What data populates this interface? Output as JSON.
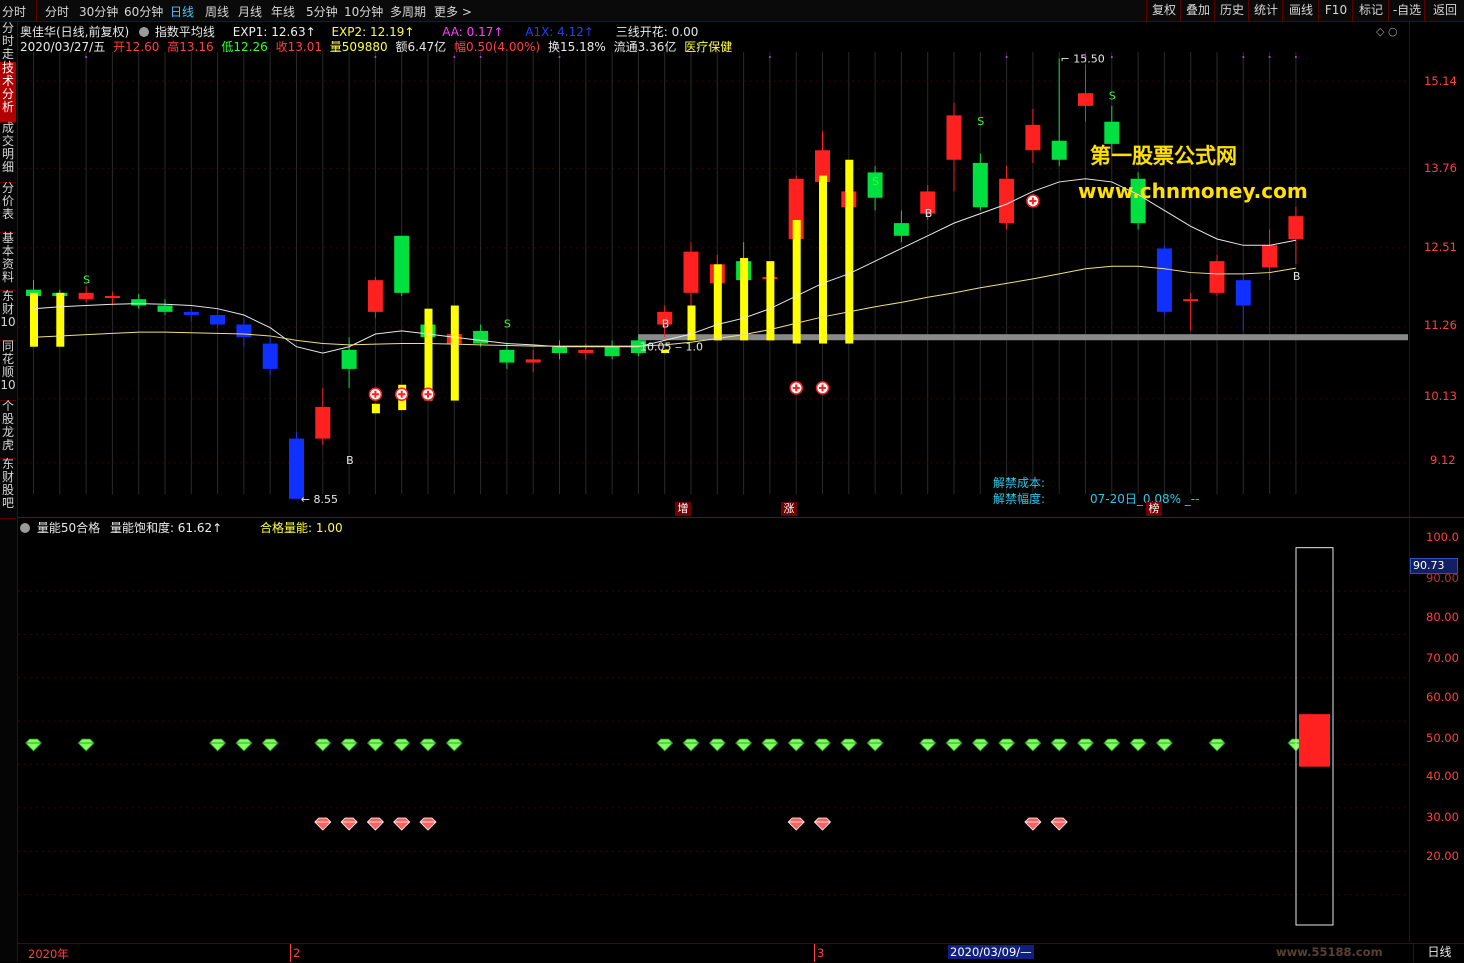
{
  "topbar": {
    "left_tab": "分时",
    "periods": [
      "分时",
      "30分钟",
      "60分钟",
      "日线",
      "周线",
      "月线",
      "年线",
      "5分钟",
      "10分钟",
      "多周期",
      "更多 >"
    ],
    "active_period": "日线",
    "right_buttons": [
      "复权",
      "叠加",
      "历史",
      "统计",
      "画线",
      "F10",
      "标记",
      "-自选",
      "返回"
    ]
  },
  "sidebar": {
    "tabs": [
      "分时走势",
      "技术分析",
      "成交明细",
      "分价表",
      "基本资料",
      "东财10",
      "同花顺10",
      "个股龙虎",
      "东财股吧"
    ],
    "active": "技术分析"
  },
  "main": {
    "stock_title": "奥佳华(日线,前复权)",
    "indicator_name": "指数平均线",
    "exp1": "EXP1: 12.63↑",
    "exp2": "EXP2: 12.19↑",
    "aa": "AA: 0.17↑",
    "a1x": "A1X: 4.12↑",
    "sanxian": "三线开花: 0.00",
    "date": "2020/03/27/五",
    "open": "开12.60",
    "high": "高13.16",
    "low": "低12.26",
    "close": "收13.01",
    "volume": "量509880",
    "amount": "额6.47亿",
    "amplitude": "幅0.50(4.00%)",
    "turnover": "换15.18%",
    "float_cap": "流通3.36亿",
    "sector": "医疗保健",
    "price_axis": [
      "15.14",
      "13.76",
      "12.51",
      "11.26",
      "10.13",
      "9.12"
    ],
    "high_marker": "15.50",
    "low_marker": "8.55",
    "mid_marker": "10.05 ‒ 1.0",
    "unlock_cost_label": "解禁成本:",
    "unlock_range_label": "解禁幅度:",
    "unlock_value": "07-20日_0.08% _--",
    "event_labels": [
      "增",
      "涨",
      "榜"
    ],
    "watermark_title": "第一股票公式网",
    "watermark_url": "www.chnmoney.com",
    "signal_s": "S",
    "signal_b": "B",
    "colors": {
      "up": "#ff2020",
      "down": "#00e040",
      "yellow": "#ffff00",
      "blue": "#1030ff",
      "ma_white": "#e8e8e8",
      "ma_yellow": "#f0e080"
    }
  },
  "sub": {
    "indicator_name": "量能50合格",
    "saturation": "量能饱和度: 61.62↑",
    "qualified": "合格量能: 1.00",
    "axis": [
      "100.0",
      "90.00",
      "80.00",
      "70.00",
      "60.00",
      "50.00",
      "40.00",
      "30.00",
      "20.00"
    ],
    "current_value": "90.73",
    "gauge_value": 61.62
  },
  "bottom": {
    "labels": [
      "2020年",
      "2",
      "3",
      "2020/03/09/—",
      "日线"
    ],
    "watermark": "www.55188.com"
  },
  "chart_data": {
    "type": "candlestick",
    "price_range": [
      8.5,
      15.6
    ],
    "candles": [
      {
        "o": 11.85,
        "c": 11.75,
        "h": 12.0,
        "l": 11.7
      },
      {
        "o": 11.8,
        "c": 11.75,
        "h": 11.85,
        "l": 11.65
      },
      {
        "o": 11.7,
        "c": 11.8,
        "h": 11.9,
        "l": 11.65
      },
      {
        "o": 11.75,
        "c": 11.75,
        "h": 11.82,
        "l": 11.6
      },
      {
        "o": 11.7,
        "c": 11.6,
        "h": 11.78,
        "l": 11.55
      },
      {
        "o": 11.6,
        "c": 11.5,
        "h": 11.7,
        "l": 11.45
      },
      {
        "o": 11.5,
        "c": 11.45,
        "h": 11.55,
        "l": 11.35
      },
      {
        "o": 11.45,
        "c": 11.3,
        "h": 11.55,
        "l": 11.25
      },
      {
        "o": 11.3,
        "c": 11.1,
        "h": 11.4,
        "l": 10.95
      },
      {
        "o": 11.0,
        "c": 10.6,
        "h": 11.1,
        "l": 10.5
      },
      {
        "o": 9.5,
        "c": 8.55,
        "h": 9.6,
        "l": 8.55
      },
      {
        "o": 9.5,
        "c": 10.0,
        "h": 10.3,
        "l": 9.4
      },
      {
        "o": 10.9,
        "c": 10.6,
        "h": 11.1,
        "l": 10.3
      },
      {
        "o": 11.5,
        "c": 12.0,
        "h": 12.05,
        "l": 11.4
      },
      {
        "o": 12.7,
        "c": 11.8,
        "h": 12.7,
        "l": 11.75
      },
      {
        "o": 11.3,
        "c": 11.1,
        "h": 11.5,
        "l": 10.8
      },
      {
        "o": 11.0,
        "c": 11.15,
        "h": 11.25,
        "l": 10.95
      },
      {
        "o": 11.2,
        "c": 11.0,
        "h": 11.3,
        "l": 10.95
      },
      {
        "o": 10.9,
        "c": 10.7,
        "h": 11.0,
        "l": 10.6
      },
      {
        "o": 10.7,
        "c": 10.75,
        "h": 10.9,
        "l": 10.55
      },
      {
        "o": 10.95,
        "c": 10.85,
        "h": 11.05,
        "l": 10.75
      },
      {
        "o": 10.85,
        "c": 10.9,
        "h": 11.0,
        "l": 10.75
      },
      {
        "o": 10.95,
        "c": 10.8,
        "h": 11.05,
        "l": 10.75
      },
      {
        "o": 11.05,
        "c": 10.85,
        "h": 11.1,
        "l": 10.8
      },
      {
        "o": 11.3,
        "c": 11.5,
        "h": 11.6,
        "l": 11.1
      },
      {
        "o": 11.8,
        "c": 12.45,
        "h": 12.6,
        "l": 11.6
      },
      {
        "o": 11.95,
        "c": 12.25,
        "h": 12.4,
        "l": 11.8
      },
      {
        "o": 12.3,
        "c": 12.0,
        "h": 12.6,
        "l": 11.6
      },
      {
        "o": 12.05,
        "c": 12.05,
        "h": 12.2,
        "l": 11.9
      },
      {
        "o": 12.65,
        "c": 13.6,
        "h": 13.65,
        "l": 12.4
      },
      {
        "o": 13.55,
        "c": 14.05,
        "h": 14.35,
        "l": 13.1
      },
      {
        "o": 13.15,
        "c": 13.4,
        "h": 13.55,
        "l": 13.05
      },
      {
        "o": 13.7,
        "c": 13.3,
        "h": 13.8,
        "l": 13.1
      },
      {
        "o": 12.9,
        "c": 12.7,
        "h": 13.1,
        "l": 12.6
      },
      {
        "o": 13.05,
        "c": 13.4,
        "h": 13.5,
        "l": 12.95
      },
      {
        "o": 13.9,
        "c": 14.6,
        "h": 14.8,
        "l": 13.4
      },
      {
        "o": 13.85,
        "c": 13.15,
        "h": 14.0,
        "l": 13.1
      },
      {
        "o": 12.9,
        "c": 13.6,
        "h": 13.8,
        "l": 12.8
      },
      {
        "o": 14.05,
        "c": 14.45,
        "h": 14.7,
        "l": 13.85
      },
      {
        "o": 14.2,
        "c": 13.9,
        "h": 15.5,
        "l": 13.8
      },
      {
        "o": 14.75,
        "c": 14.95,
        "h": 15.4,
        "l": 14.5
      },
      {
        "o": 14.5,
        "c": 14.15,
        "h": 14.75,
        "l": 14.0
      },
      {
        "o": 13.6,
        "c": 12.9,
        "h": 13.7,
        "l": 12.8
      },
      {
        "o": 12.5,
        "c": 11.5,
        "h": 12.55,
        "l": 11.45
      },
      {
        "o": 11.7,
        "c": 11.7,
        "h": 11.8,
        "l": 11.2
      },
      {
        "o": 11.8,
        "c": 12.3,
        "h": 12.4,
        "l": 11.75
      },
      {
        "o": 12.0,
        "c": 11.6,
        "h": 12.1,
        "l": 11.2
      },
      {
        "o": 12.2,
        "c": 12.55,
        "h": 12.8,
        "l": 12.0
      },
      {
        "o": 12.65,
        "c": 13.01,
        "h": 13.16,
        "l": 12.26
      }
    ],
    "ma1": [
      11.55,
      11.58,
      11.6,
      11.62,
      11.63,
      11.62,
      11.6,
      11.55,
      11.45,
      11.25,
      10.95,
      10.85,
      10.95,
      11.15,
      11.2,
      11.15,
      11.1,
      11.05,
      11.0,
      10.98,
      10.95,
      10.95,
      10.95,
      10.95,
      11.05,
      11.15,
      11.3,
      11.4,
      11.55,
      11.75,
      11.95,
      12.1,
      12.3,
      12.5,
      12.7,
      12.9,
      13.05,
      13.2,
      13.4,
      13.55,
      13.6,
      13.55,
      13.35,
      13.1,
      12.85,
      12.65,
      12.55,
      12.55,
      12.63
    ],
    "ma2": [
      11.1,
      11.12,
      11.14,
      11.16,
      11.18,
      11.18,
      11.17,
      11.16,
      11.15,
      11.12,
      11.05,
      11.0,
      10.98,
      10.99,
      11.0,
      11.0,
      10.99,
      10.98,
      10.97,
      10.96,
      10.96,
      10.96,
      10.96,
      10.96,
      10.98,
      11.02,
      11.08,
      11.14,
      11.22,
      11.32,
      11.42,
      11.5,
      11.58,
      11.65,
      11.73,
      11.8,
      11.88,
      11.95,
      12.02,
      12.1,
      12.18,
      12.22,
      12.22,
      12.18,
      12.12,
      12.1,
      12.1,
      12.12,
      12.19
    ]
  }
}
